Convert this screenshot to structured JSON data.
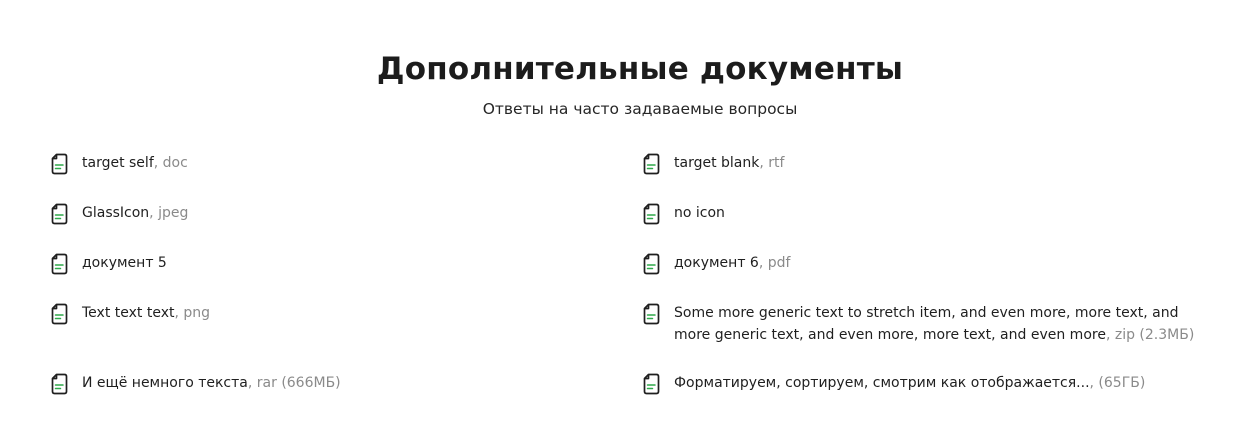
{
  "header": {
    "title": "Дополнительные документы",
    "subtitle": "Ответы на часто задаваемые вопросы"
  },
  "colors": {
    "icon_stroke": "#1f1f1f",
    "icon_accent": "#2ea84a",
    "extension_text": "#8a8a8a"
  },
  "documents": [
    {
      "name": "target self",
      "ext": ", doc",
      "icon": "document-icon"
    },
    {
      "name": "target blank",
      "ext": ", rtf",
      "icon": "document-icon"
    },
    {
      "name": "GlassIcon",
      "ext": ", jpeg",
      "icon": "document-icon"
    },
    {
      "name": "no icon",
      "ext": "",
      "icon": "document-icon"
    },
    {
      "name": "документ 5",
      "ext": "",
      "icon": "document-icon"
    },
    {
      "name": "документ 6",
      "ext": ", pdf",
      "icon": "document-icon"
    },
    {
      "name": "Text text text",
      "ext": ", png",
      "icon": "document-icon"
    },
    {
      "name": "Some more generic text to stretch item, and even more, more text, and more generic text, and even more, more text, and even more",
      "ext": ", zip (2.3МБ)",
      "icon": "document-icon"
    },
    {
      "name": "И ещё немного текста",
      "ext": ", rar (666МБ)",
      "icon": "document-icon"
    },
    {
      "name": "Форматируем, сортируем, смотрим как отображается...",
      "ext": ", (65ГБ)",
      "icon": "document-icon"
    }
  ]
}
